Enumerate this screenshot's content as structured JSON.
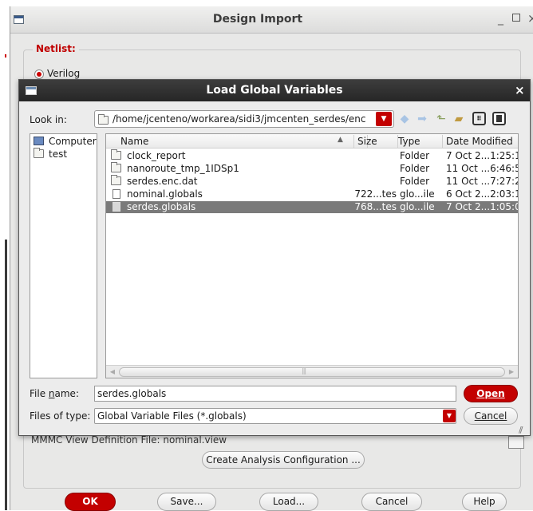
{
  "design_import": {
    "title": "Design Import",
    "netlist_label": "Netlist:",
    "verilog_label": "Verilog",
    "mmmc_label": "MMMC View Definition File: nominal.view",
    "create_analysis_label": "Create Analysis Configuration ...",
    "buttons": {
      "ok": "OK",
      "save": "Save...",
      "load": "Load...",
      "cancel": "Cancel",
      "help": "Help"
    }
  },
  "load_dialog": {
    "title": "Load Global Variables",
    "look_in_label": "Look in:",
    "look_in_path": "/home/jcenteno/workarea/sidi3/jmcenten_serdes/enc",
    "places": [
      {
        "label": "Computer",
        "icon": "computer-icon"
      },
      {
        "label": "test",
        "icon": "folder-icon"
      }
    ],
    "columns": {
      "name": "Name",
      "size": "Size",
      "type": "Type",
      "date": "Date Modified"
    },
    "files": [
      {
        "name": "clock_report",
        "size": "",
        "type": "Folder",
        "date": "7 Oct 2...1:25:1",
        "icon": "folder-icon"
      },
      {
        "name": "nanoroute_tmp_1IDSp1",
        "size": "",
        "type": "Folder",
        "date": "11 Oct ...6:46:5",
        "icon": "folder-icon"
      },
      {
        "name": "serdes.enc.dat",
        "size": "",
        "type": "Folder",
        "date": "11 Oct ...7:27:2",
        "icon": "folder-icon"
      },
      {
        "name": "nominal.globals",
        "size": "722...tes",
        "type": "glo...ile",
        "date": "6 Oct 2...2:03:1",
        "icon": "file-icon"
      },
      {
        "name": "serdes.globals",
        "size": "768...tes",
        "type": "glo...ile",
        "date": "7 Oct 2...1:05:0",
        "icon": "file-icon",
        "selected": true
      }
    ],
    "file_name_label": "File name:",
    "file_name_value": "serdes.globals",
    "files_of_type_label": "Files of type:",
    "files_of_type_value": "Global Variable Files (*.globals)",
    "open_label": "Open",
    "cancel_label": "Cancel"
  },
  "colors": {
    "accent_red": "#c30000",
    "selection": "#7a7a7a",
    "titlebar_dark": "#2e2e2e"
  }
}
